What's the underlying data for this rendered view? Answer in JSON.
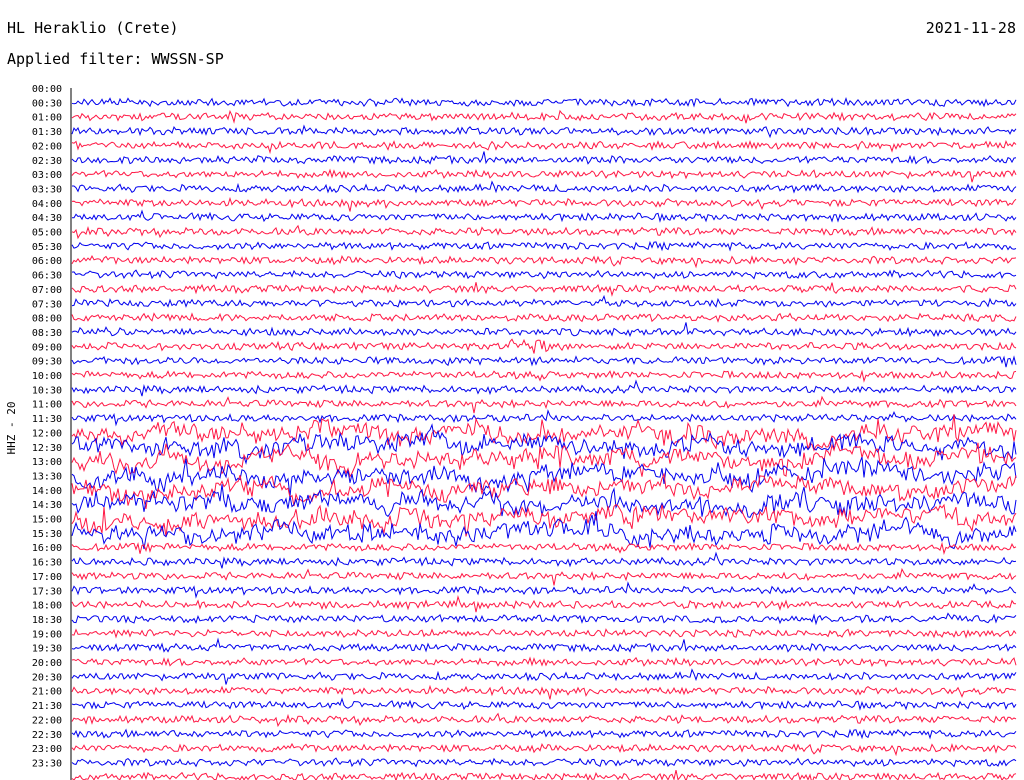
{
  "header": {
    "station": "HL Heraklio (Crete)",
    "date": "2021-11-28",
    "filter": "Applied filter: WWSSN-SP"
  },
  "chart_data": {
    "type": "helicorder",
    "title": "HL Heraklio (Crete)",
    "channel_label": "HHZ - 20",
    "row_labels": [
      "00:00",
      "00:30",
      "01:00",
      "01:30",
      "02:00",
      "02:30",
      "03:00",
      "03:30",
      "04:00",
      "04:30",
      "05:00",
      "05:30",
      "06:00",
      "06:30",
      "07:00",
      "07:30",
      "08:00",
      "08:30",
      "09:00",
      "09:30",
      "10:00",
      "10:30",
      "11:00",
      "11:30",
      "12:00",
      "12:30",
      "13:00",
      "13:30",
      "14:00",
      "14:30",
      "15:00",
      "15:30",
      "16:00",
      "16:30",
      "17:00",
      "17:30",
      "18:00",
      "18:30",
      "19:00",
      "19:30",
      "20:00",
      "20:30",
      "21:00",
      "21:30",
      "22:00",
      "22:30",
      "23:00",
      "23:30"
    ],
    "trace_colors": [
      "#0000ee",
      "#ff1744"
    ],
    "start_row_index": 1,
    "high_activity_rows": [
      "12:00",
      "12:30",
      "13:00",
      "13:30",
      "14:00",
      "14:30",
      "15:00",
      "15:30"
    ],
    "event_markers": [
      {
        "row": "09:00",
        "x_fraction": 0.46
      }
    ]
  }
}
